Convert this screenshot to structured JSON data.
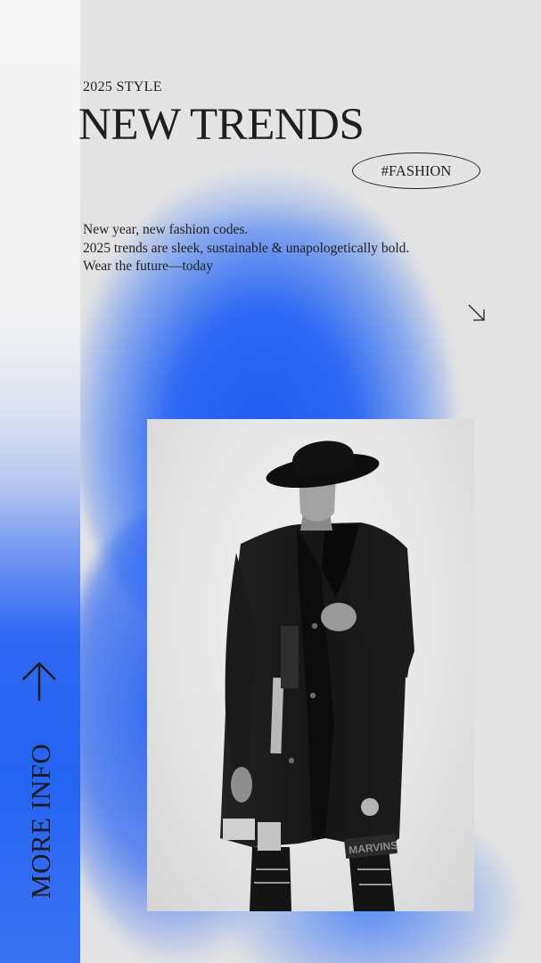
{
  "header": {
    "eyebrow": "2025 STYLE",
    "headline": "NEW TRENDS",
    "tag": "#FASHION"
  },
  "blurb": {
    "lines": [
      "New year, new fashion codes.",
      "2025 trends are sleek, sustainable & unapologetically bold.",
      "Wear the future—today"
    ]
  },
  "icons": {
    "diagonal_arrow": "arrow-down-right-icon",
    "up_arrow": "arrow-up-icon"
  },
  "photo": {
    "coat_patch_text": "MARVINS",
    "description_icon": "fashion-model-photo"
  },
  "sidebar": {
    "cta_label": "MORE INFO"
  },
  "colors": {
    "accent_blue": "#2563f2",
    "background": "#e3e3e4",
    "text": "#1f1f1f"
  }
}
